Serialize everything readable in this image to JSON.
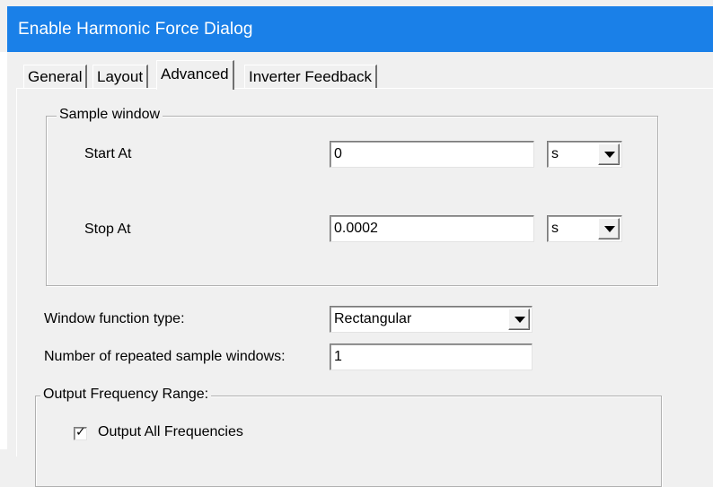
{
  "window": {
    "title": "Enable Harmonic Force Dialog"
  },
  "tabs": [
    {
      "label": "General",
      "active": false
    },
    {
      "label": "Layout",
      "active": false
    },
    {
      "label": "Advanced",
      "active": true
    },
    {
      "label": "Inverter Feedback",
      "active": false
    }
  ],
  "sample_window": {
    "group_label": "Sample window",
    "start": {
      "label": "Start At",
      "value": "0",
      "unit": "s"
    },
    "stop": {
      "label": "Stop At",
      "value": "0.0002",
      "unit": "s"
    }
  },
  "window_function": {
    "label": "Window function type:",
    "value": "Rectangular"
  },
  "repeated_windows": {
    "label": "Number of repeated sample windows:",
    "value": "1"
  },
  "output_range": {
    "group_label": "Output Frequency Range:",
    "all_frequencies": {
      "label": "Output All Frequencies",
      "checked": true
    }
  },
  "colors": {
    "titlebar": "#1a80e8",
    "background": "#f0f0f0"
  }
}
